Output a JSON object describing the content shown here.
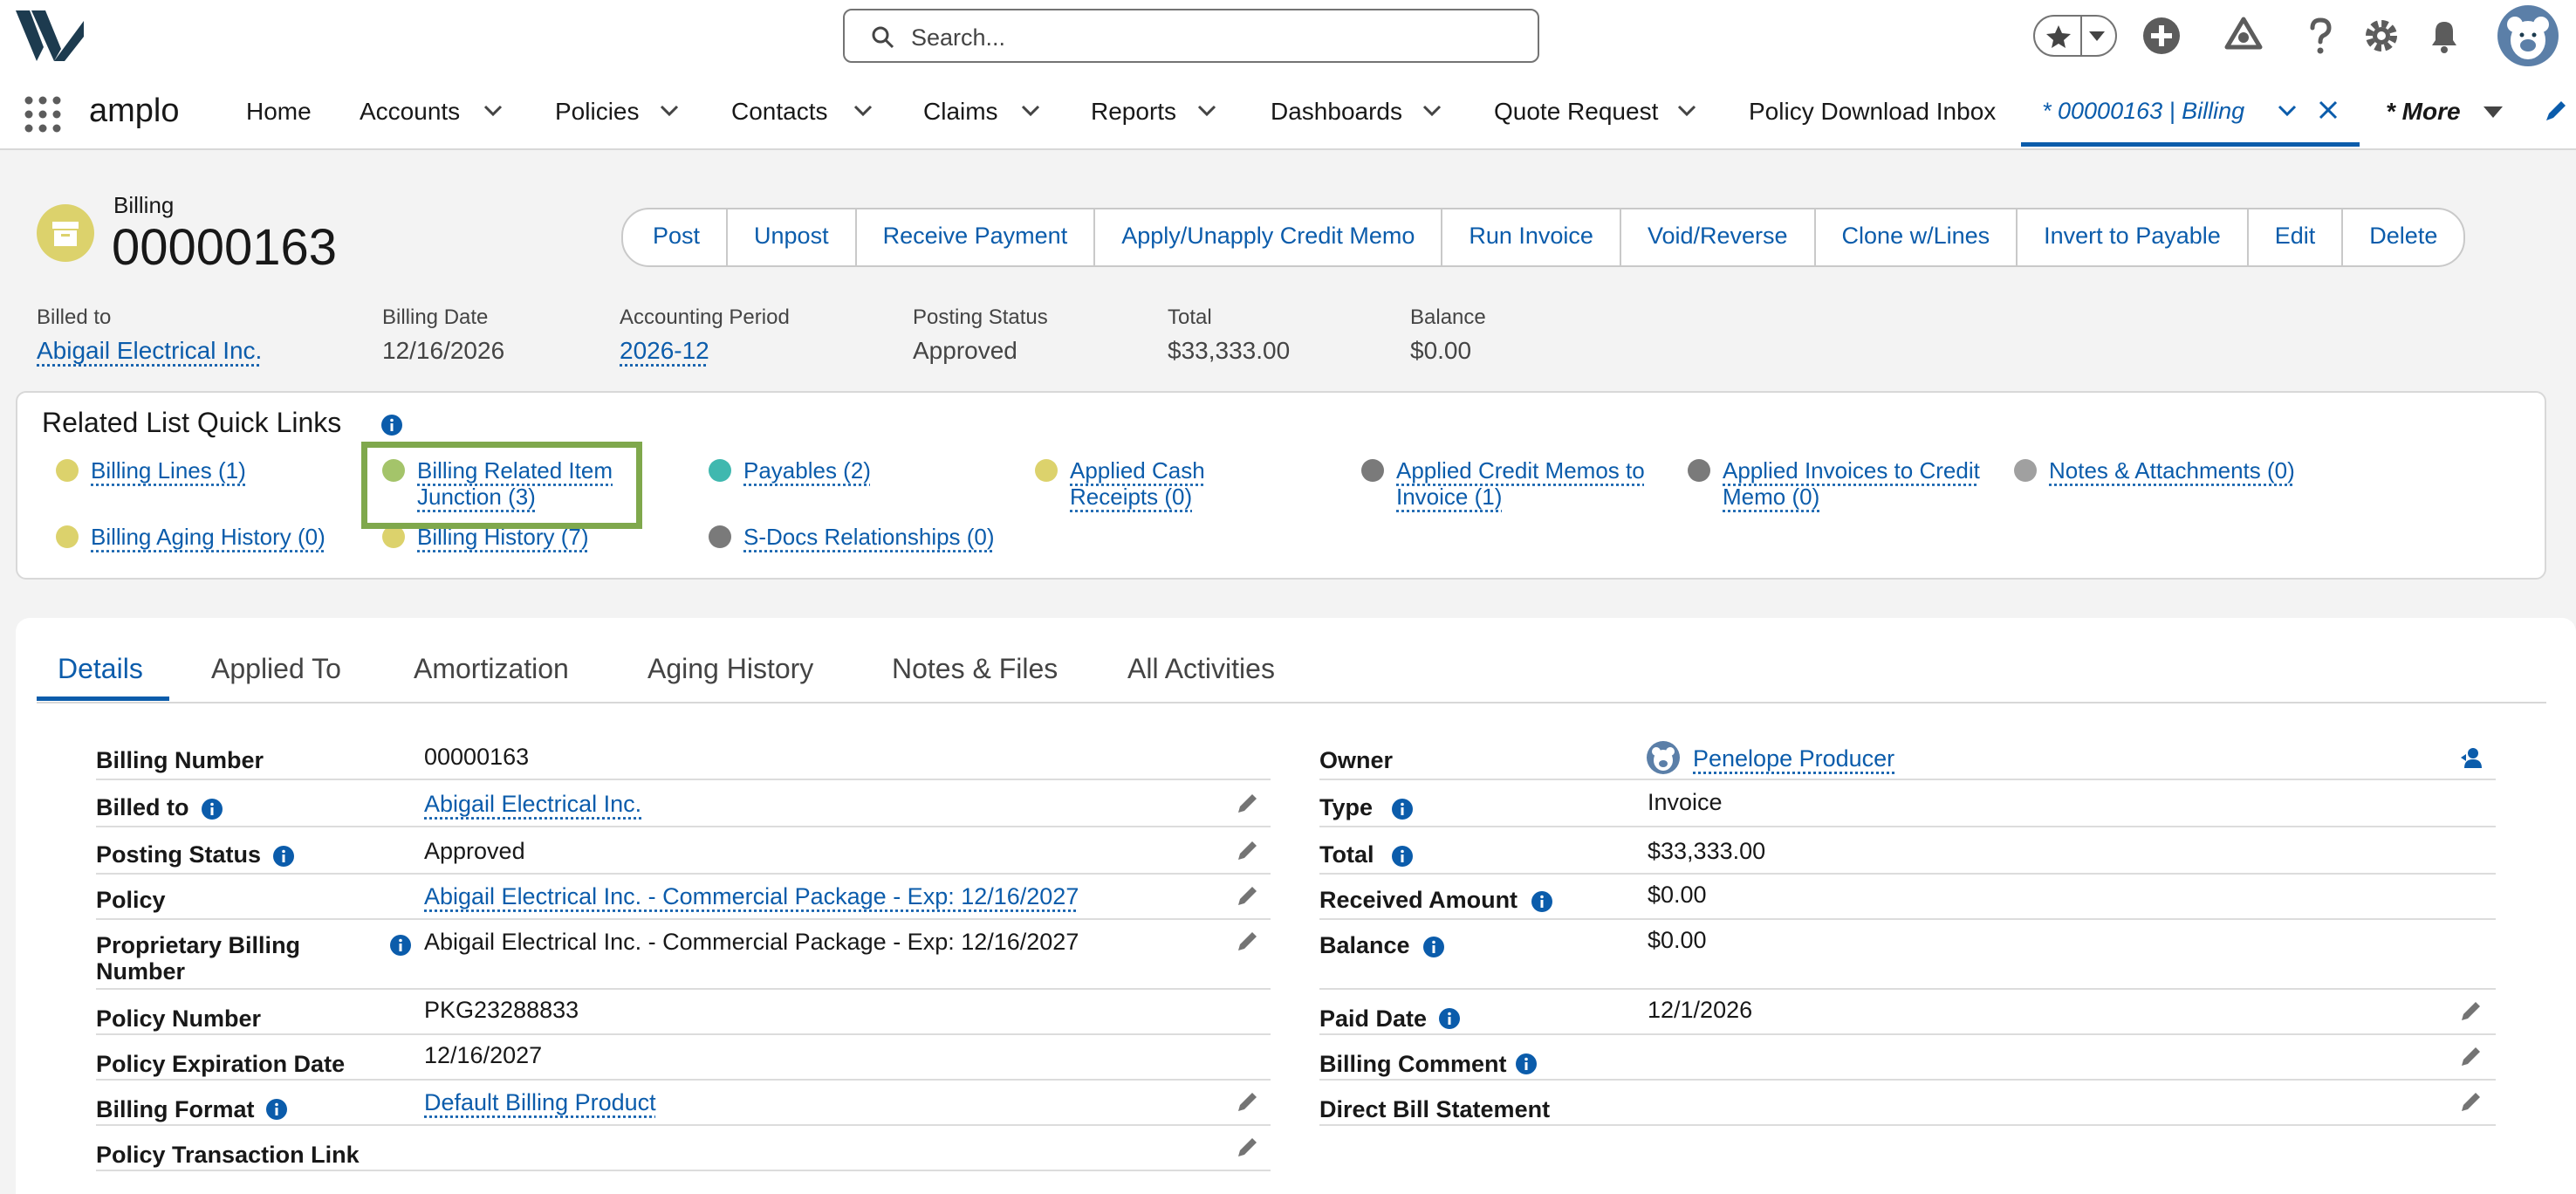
{
  "header": {
    "search_placeholder": "Search...",
    "icons": [
      "favorites-star-icon",
      "add-icon",
      "trailhead-icon",
      "help-icon",
      "setup-gear-icon",
      "notifications-bell-icon",
      "user-avatar"
    ]
  },
  "nav": {
    "app_name": "amplo",
    "items": [
      {
        "label": "Home",
        "chevron": false
      },
      {
        "label": "Accounts",
        "chevron": true
      },
      {
        "label": "Policies",
        "chevron": true
      },
      {
        "label": "Contacts",
        "chevron": true
      },
      {
        "label": "Claims",
        "chevron": true
      },
      {
        "label": "Reports",
        "chevron": true
      },
      {
        "label": "Dashboards",
        "chevron": true
      },
      {
        "label": "Quote Request",
        "chevron": true
      },
      {
        "label": "Policy Download Inbox",
        "chevron": false
      }
    ],
    "active_tab": "* 00000163 | Billing",
    "more_label": "* More"
  },
  "record": {
    "object_type": "Billing",
    "title": "00000163",
    "actions": [
      "Post",
      "Unpost",
      "Receive Payment",
      "Apply/Unapply Credit Memo",
      "Run Invoice",
      "Void/Reverse",
      "Clone w/Lines",
      "Invert to Payable",
      "Edit",
      "Delete"
    ],
    "highlights": [
      {
        "label": "Billed to",
        "value": "Abigail Electrical Inc.",
        "link": true
      },
      {
        "label": "Billing Date",
        "value": "12/16/2026",
        "link": false
      },
      {
        "label": "Accounting Period",
        "value": "2026-12",
        "link": true
      },
      {
        "label": "Posting Status",
        "value": "Approved",
        "link": false
      },
      {
        "label": "Total",
        "value": "$33,333.00",
        "link": false
      },
      {
        "label": "Balance",
        "value": "$0.00",
        "link": false
      }
    ]
  },
  "quick_links": {
    "title": "Related List Quick Links",
    "items": [
      {
        "label": "Billing Lines (1)",
        "color": "#dcd26c"
      },
      {
        "label": "Billing Related Item Junction (3)",
        "color": "#a4c46a"
      },
      {
        "label": "Payables (2)",
        "color": "#3fb8af"
      },
      {
        "label": "Applied Cash Receipts (0)",
        "color": "#dcd26c"
      },
      {
        "label": "Applied Credit Memos to Invoice (1)",
        "color": "#7a7a7a"
      },
      {
        "label": "Applied Invoices to Credit Memo (0)",
        "color": "#7a7a7a"
      },
      {
        "label": "Notes & Attachments (0)",
        "color": "#a0a0a0"
      },
      {
        "label": "Billing Aging History (0)",
        "color": "#dcd26c"
      },
      {
        "label": "Billing History (7)",
        "color": "#dcd26c"
      },
      {
        "label": "S-Docs Relationships (0)",
        "color": "#7a7a7a"
      }
    ]
  },
  "tabs": [
    "Details",
    "Applied To",
    "Amortization",
    "Aging History",
    "Notes & Files",
    "All Activities"
  ],
  "details_left": [
    {
      "label": "Billing Number",
      "value": "00000163",
      "link": false,
      "info": false,
      "edit": false
    },
    {
      "label": "Billed to",
      "value": "Abigail Electrical Inc.",
      "link": true,
      "info": true,
      "edit": true
    },
    {
      "label": "Posting Status",
      "value": "Approved",
      "link": false,
      "info": true,
      "edit": true
    },
    {
      "label": "Policy",
      "value": "Abigail Electrical Inc. - Commercial Package - Exp: 12/16/2027",
      "link": true,
      "info": false,
      "edit": true
    },
    {
      "label": "Proprietary Billing Number",
      "value": "Abigail Electrical Inc. - Commercial Package - Exp: 12/16/2027",
      "link": false,
      "info": true,
      "edit": true
    },
    {
      "label": "Policy Number",
      "value": "PKG23288833",
      "link": false,
      "info": false,
      "edit": false
    },
    {
      "label": "Policy Expiration Date",
      "value": "12/16/2027",
      "link": false,
      "info": false,
      "edit": false
    },
    {
      "label": "Billing Format",
      "value": "Default Billing Product",
      "link": true,
      "info": true,
      "edit": true
    },
    {
      "label": "Policy Transaction Link",
      "value": "",
      "link": false,
      "info": false,
      "edit": true
    }
  ],
  "details_right": [
    {
      "label": "Owner",
      "value": "Penelope Producer",
      "link": true,
      "info": false,
      "edit": false
    },
    {
      "label": "Type",
      "value": "Invoice",
      "link": false,
      "info": true,
      "edit": false
    },
    {
      "label": "Total",
      "value": "$33,333.00",
      "link": false,
      "info": true,
      "edit": false
    },
    {
      "label": "Received Amount",
      "value": "$0.00",
      "link": false,
      "info": true,
      "edit": false
    },
    {
      "label": "Balance",
      "value": "$0.00",
      "link": false,
      "info": true,
      "edit": false
    },
    {
      "label": "Paid Date",
      "value": "12/1/2026",
      "link": false,
      "info": true,
      "edit": true
    },
    {
      "label": "Billing Comment",
      "value": "",
      "link": false,
      "info": true,
      "edit": true
    },
    {
      "label": "Direct Bill Statement",
      "value": "",
      "link": false,
      "info": false,
      "edit": true
    }
  ]
}
